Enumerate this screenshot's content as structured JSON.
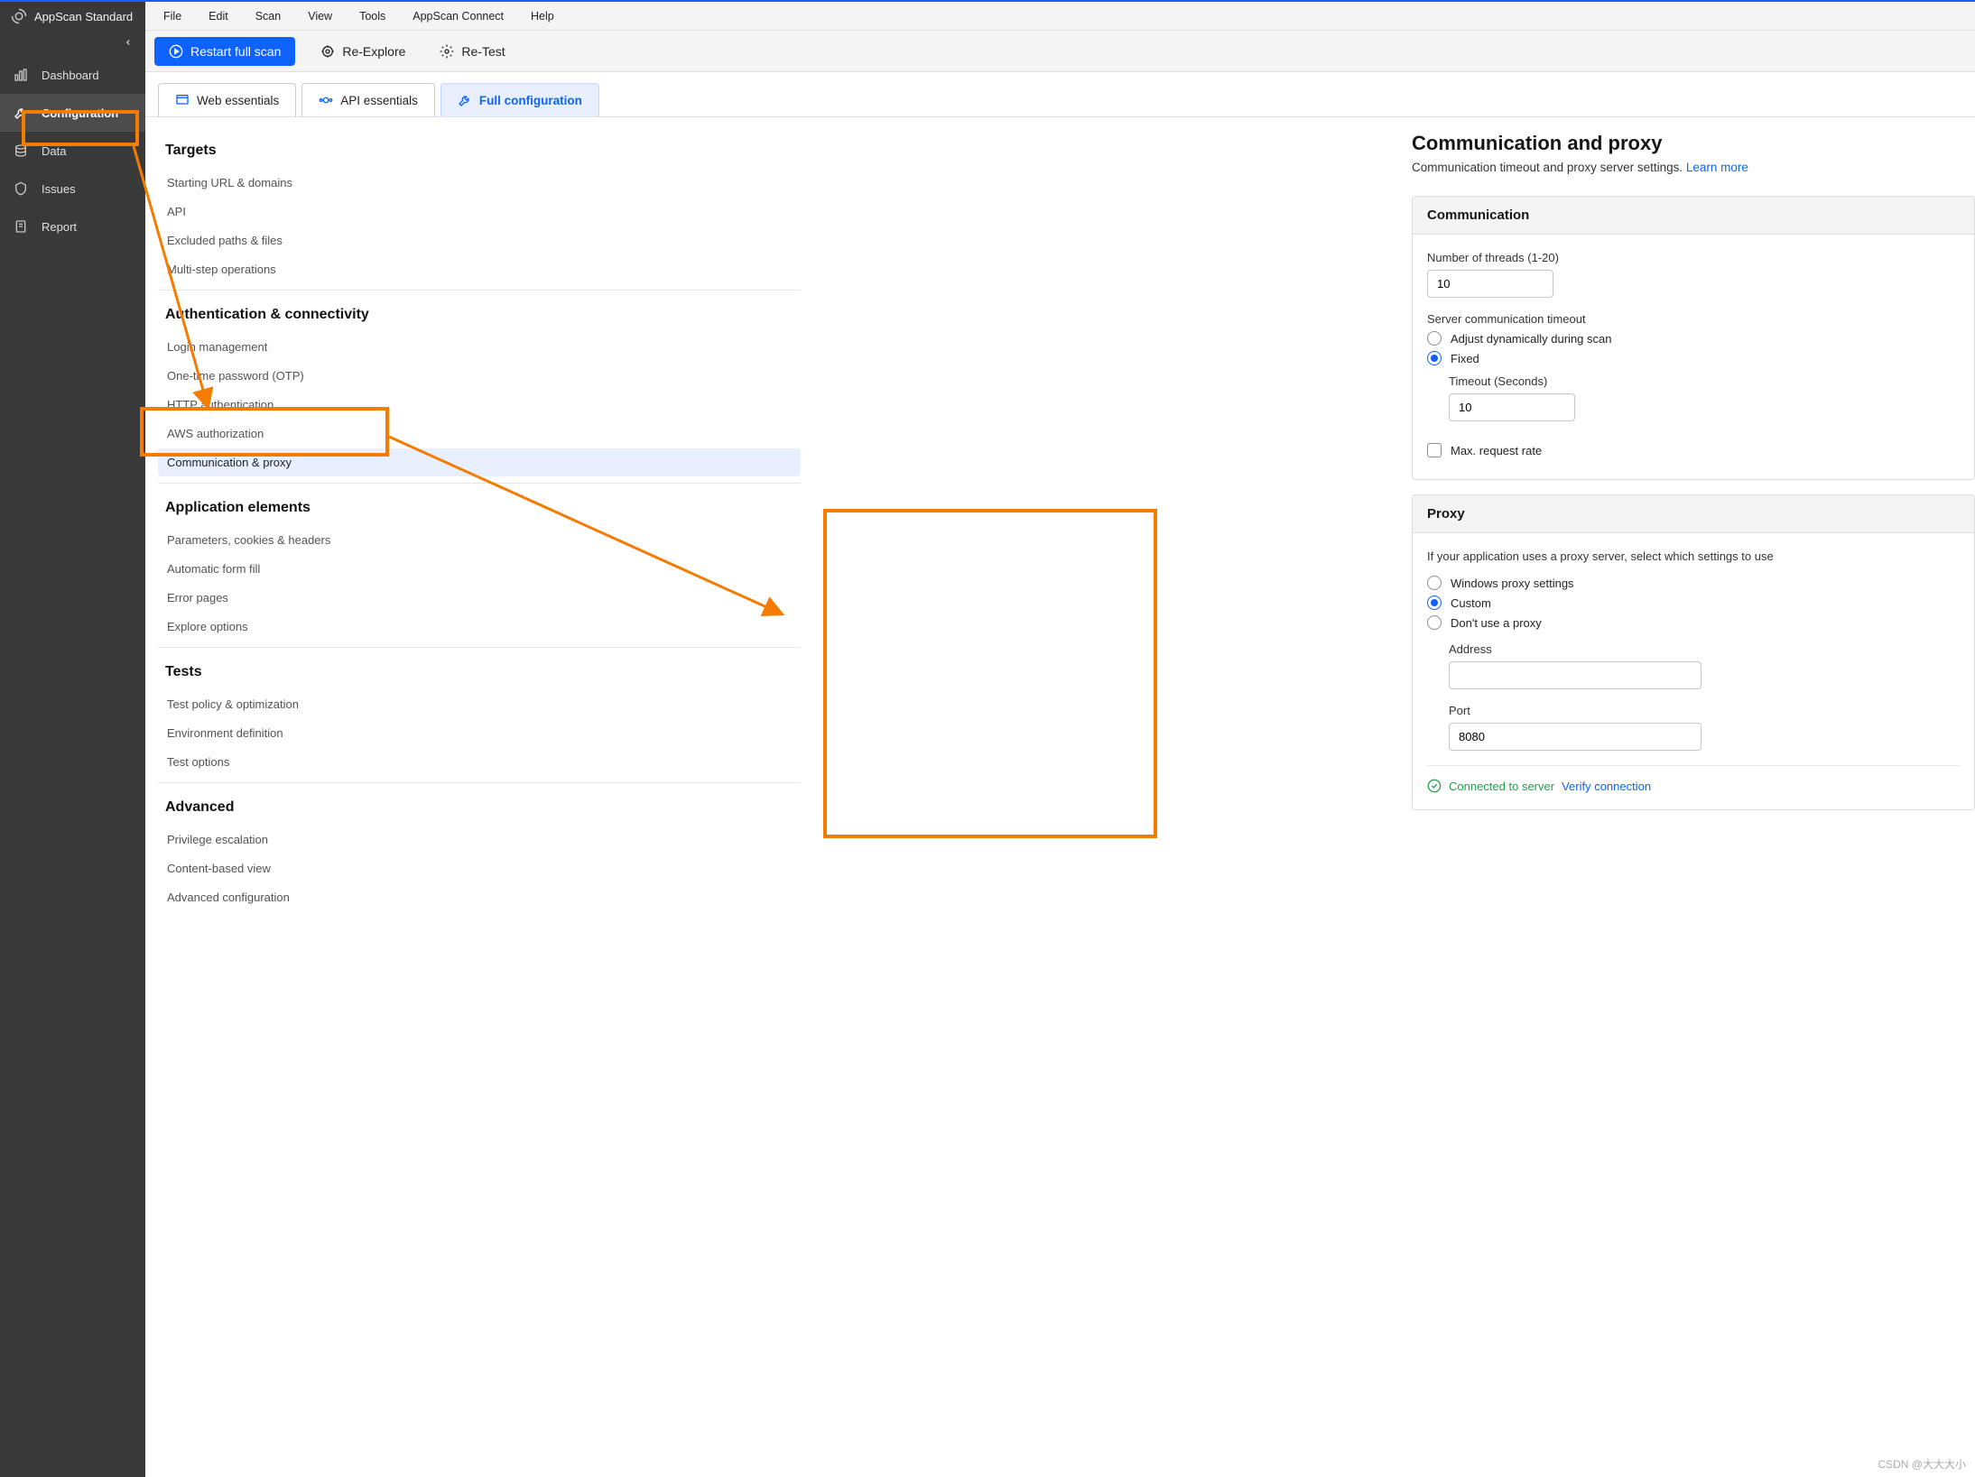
{
  "app_name": "AppScan Standard",
  "menubar": [
    "File",
    "Edit",
    "Scan",
    "View",
    "Tools",
    "AppScan Connect",
    "Help"
  ],
  "toolbar": {
    "restart": "Restart full scan",
    "reexplore": "Re-Explore",
    "retest": "Re-Test"
  },
  "sidebar": {
    "items": [
      {
        "label": "Dashboard"
      },
      {
        "label": "Configuration"
      },
      {
        "label": "Data"
      },
      {
        "label": "Issues"
      },
      {
        "label": "Report"
      }
    ]
  },
  "tabs": {
    "web": "Web essentials",
    "api": "API essentials",
    "full": "Full configuration"
  },
  "tree": {
    "targets": {
      "title": "Targets",
      "items": [
        "Starting URL & domains",
        "API",
        "Excluded paths & files",
        "Multi-step operations"
      ]
    },
    "auth": {
      "title": "Authentication & connectivity",
      "items": [
        "Login management",
        "One-time password (OTP)",
        "HTTP authentication",
        "AWS authorization",
        "Communication & proxy"
      ]
    },
    "appel": {
      "title": "Application elements",
      "items": [
        "Parameters, cookies & headers",
        "Automatic form fill",
        "Error pages",
        "Explore options"
      ]
    },
    "tests": {
      "title": "Tests",
      "items": [
        "Test policy & optimization",
        "Environment definition",
        "Test options"
      ]
    },
    "advanced": {
      "title": "Advanced",
      "items": [
        "Privilege escalation",
        "Content-based view",
        "Advanced configuration"
      ]
    }
  },
  "page": {
    "title": "Communication and proxy",
    "subtitle": "Communication timeout and proxy server settings. ",
    "learn_more": "Learn more"
  },
  "communication": {
    "header": "Communication",
    "threads_label": "Number of threads (1-20)",
    "threads_value": "10",
    "timeout_label": "Server communication timeout",
    "opt_dynamic": "Adjust dynamically during scan",
    "opt_fixed": "Fixed",
    "timeout_seconds_label": "Timeout (Seconds)",
    "timeout_seconds_value": "10",
    "max_rate": "Max. request  rate"
  },
  "proxy": {
    "header": "Proxy",
    "desc": "If your application uses a proxy server, select which settings to use",
    "opt_windows": "Windows proxy settings",
    "opt_custom": "Custom",
    "opt_none": "Don't use a proxy",
    "address_label": "Address",
    "address_value": "",
    "port_label": "Port",
    "port_value": "8080",
    "connected": "Connected to server",
    "verify": "Verify connection"
  },
  "watermark": "CSDN @大大大小"
}
